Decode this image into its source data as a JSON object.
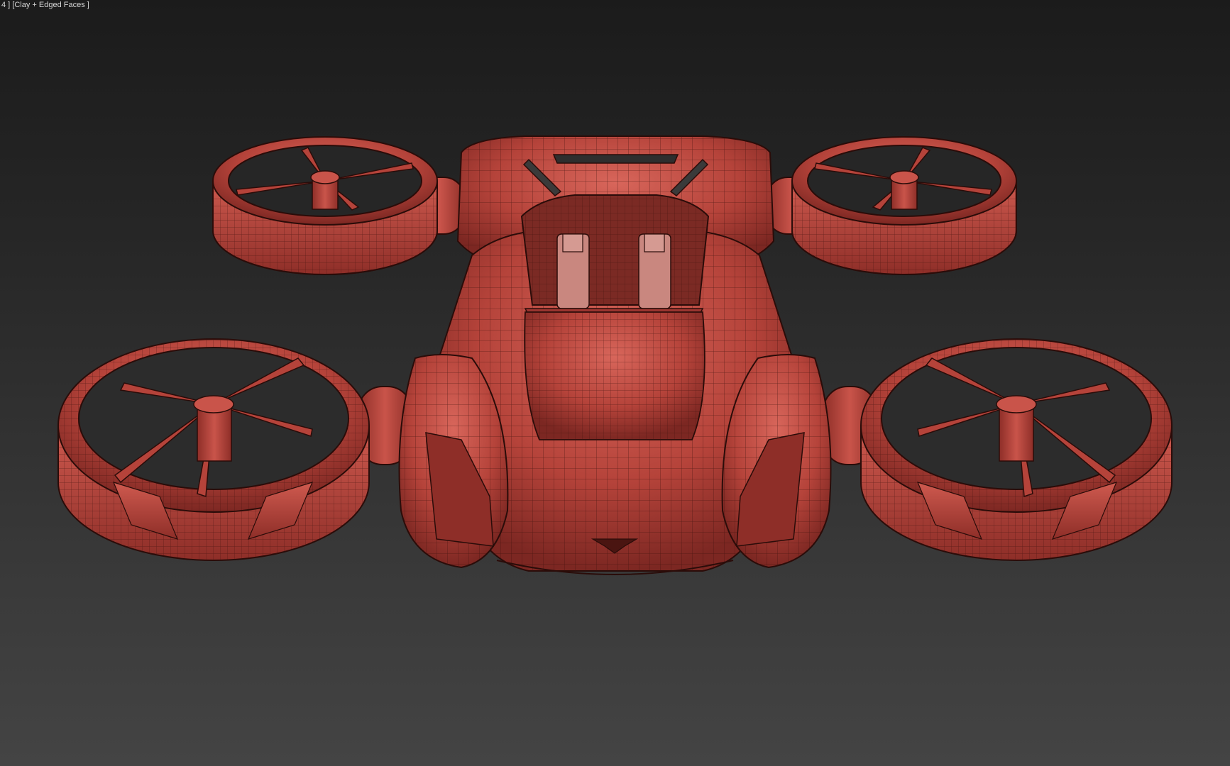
{
  "viewport": {
    "label": "4 ] [Clay + Edged Faces ]",
    "background_top": "#1b1b1b",
    "background_bottom": "#444444"
  },
  "model": {
    "clay_color": "#b5433a",
    "edge_color": "#2a0c09",
    "icon": "drone-car-mesh"
  }
}
